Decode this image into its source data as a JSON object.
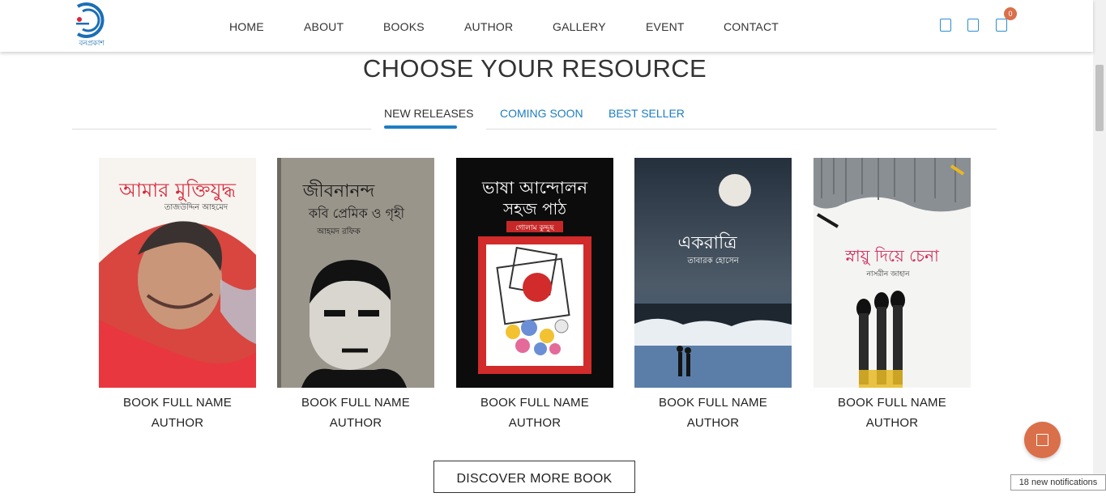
{
  "header": {
    "logo_text": "বনপ্রকাশ",
    "nav": [
      "HOME",
      "ABOUT",
      "BOOKS",
      "AUTHOR",
      "GALLERY",
      "EVENT",
      "CONTACT"
    ],
    "icons": [
      "search-icon",
      "user-icon",
      "cart-icon"
    ],
    "cart_count": "0"
  },
  "section": {
    "title": "CHOOSE YOUR RESOURCE",
    "tabs": [
      "NEW RELEASES",
      "COMING SOON",
      "BEST SELLER"
    ],
    "active_tab": "NEW RELEASES"
  },
  "books": [
    {
      "cover_title": "আমার মুক্তিযুদ্ধ",
      "cover_author": "তাজউদ্দিন আহমেদ",
      "name": "BOOK FULL NAME",
      "author": "AUTHOR"
    },
    {
      "cover_title": "জীবনানন্দ",
      "cover_subtitle": "কবি প্রেমিক ও গৃহী",
      "cover_author": "আহমদ রফিক",
      "name": "BOOK FULL NAME",
      "author": "AUTHOR"
    },
    {
      "cover_title": "ভাষা আন্দোলন",
      "cover_subtitle": "সহজ পাঠ",
      "cover_author": "গোলাম কুদ্দুছ",
      "name": "BOOK FULL NAME",
      "author": "AUTHOR"
    },
    {
      "cover_title": "একরাত্রি",
      "cover_author": "তাবারক হোসেন",
      "name": "BOOK FULL NAME",
      "author": "AUTHOR"
    },
    {
      "cover_title": "স্নায়ু দিয়ে চেনা",
      "cover_author": "নাসরীন জাহান",
      "name": "BOOK FULL NAME",
      "author": "AUTHOR"
    }
  ],
  "discover_label": "DISCOVER MORE BOOK",
  "notification": "18 new notifications",
  "colors": {
    "accent": "#1d7ec1",
    "chat": "#d9704a"
  }
}
